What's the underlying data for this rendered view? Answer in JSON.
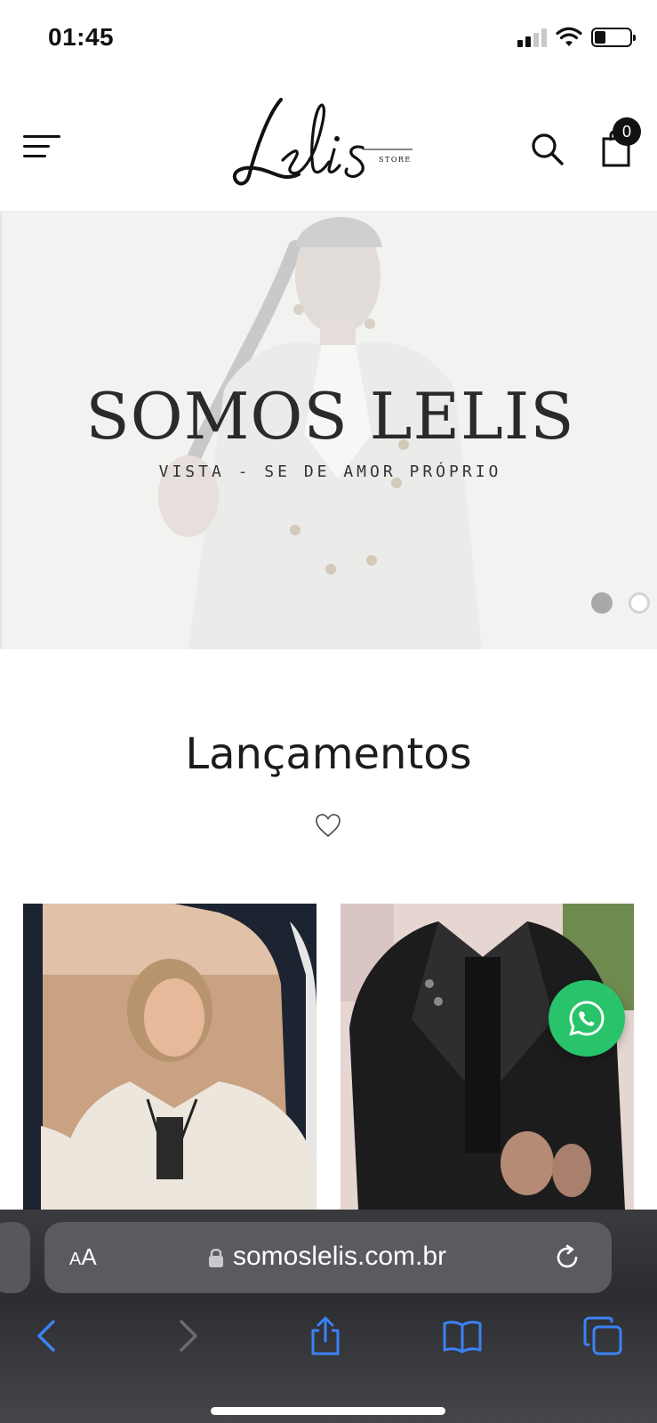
{
  "status_bar": {
    "time": "01:45"
  },
  "header": {
    "logo_text": "Lelis",
    "logo_subtext": "STORE",
    "cart_count": "0"
  },
  "hero": {
    "title": "SOMOS LELIS",
    "subtitle": "VISTA - SE DE AMOR PRÓPRIO",
    "slide_count": 2,
    "active_slide": 1
  },
  "section": {
    "title": "Lançamentos",
    "icon": "heart-icon"
  },
  "products": [
    {
      "image": "woman in cream coat"
    },
    {
      "image": "black leather jacket"
    }
  ],
  "browser": {
    "aa_small": "A",
    "aa_big": "A",
    "url": "somoslelis.com.br"
  },
  "colors": {
    "whatsapp": "#28c36a",
    "badge": "#111111",
    "browser_bar": "#3a3b3f",
    "browser_icon": "#3b82f6"
  }
}
